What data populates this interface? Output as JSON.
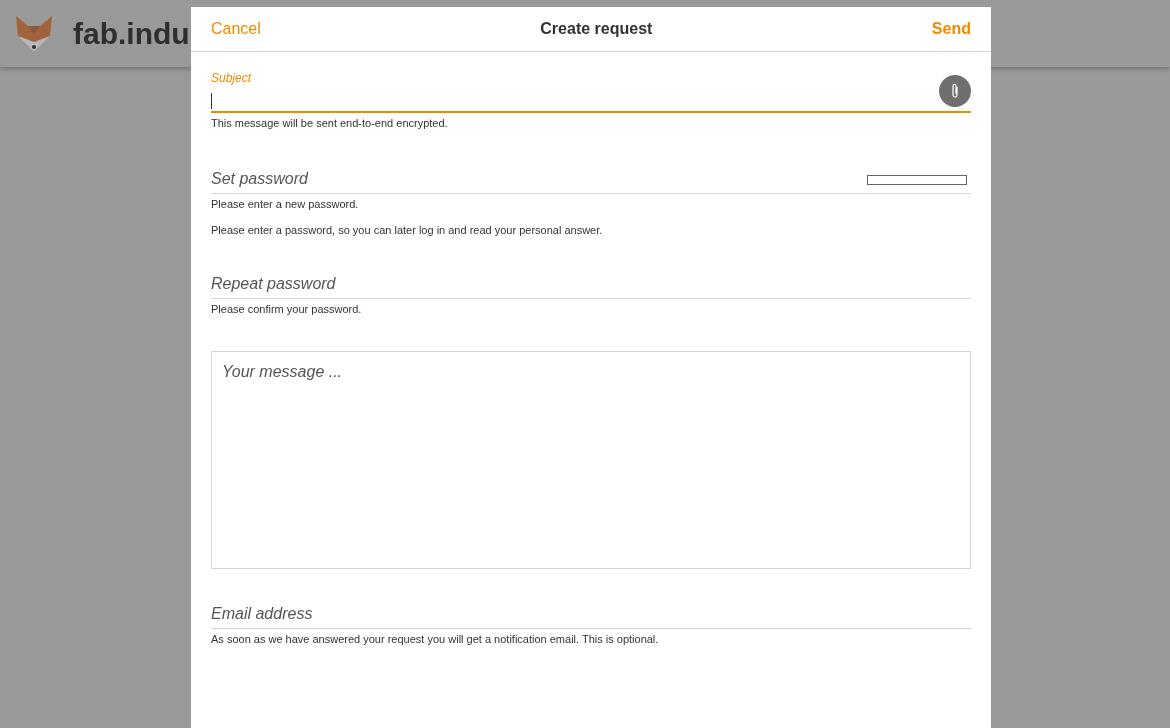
{
  "app_header": {
    "title": "fab.indu"
  },
  "dialog": {
    "cancel": "Cancel",
    "title": "Create request",
    "send": "Send"
  },
  "subject": {
    "label": "Subject",
    "focused": true,
    "hint": "This message will be sent end-to-end encrypted."
  },
  "password": {
    "placeholder": "Set password",
    "hints": [
      "Please enter a new password.",
      "Please enter a password, so you can later log in and read your personal answer."
    ],
    "strength": {
      "level": 0
    }
  },
  "repeat_password": {
    "placeholder": "Repeat password",
    "hint": "Please confirm your password."
  },
  "message": {
    "placeholder": "Your message ..."
  },
  "email": {
    "placeholder": "Email address",
    "hint": "As soon as we have answered your request you will get a notification email. This is optional."
  }
}
